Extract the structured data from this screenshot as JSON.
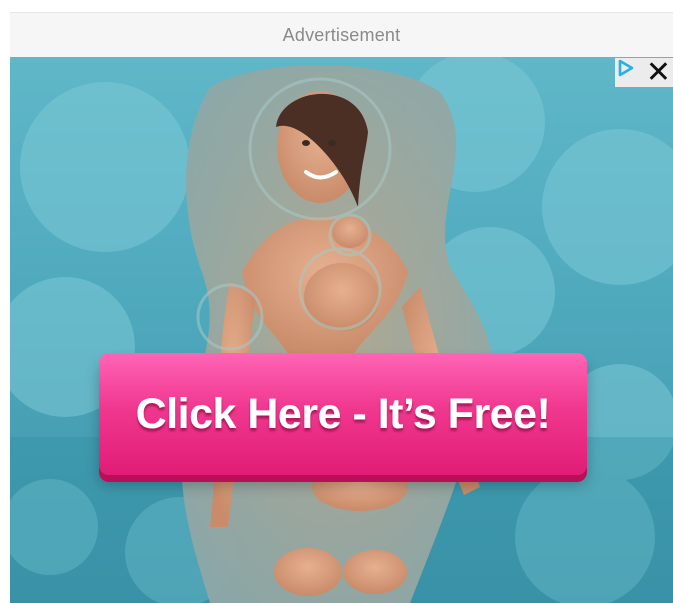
{
  "ad": {
    "header_label": "Advertisement",
    "cta_label": "Click Here - It’s Free!",
    "adchoices_icon": "adchoices-icon",
    "close_icon": "close-icon",
    "close_glyph": "✕",
    "colors": {
      "background_water": "#4fa9bd",
      "cta_pink": "#f0388f",
      "cta_shadow": "#b80f57",
      "adchoices_blue": "#27b0e6"
    }
  }
}
